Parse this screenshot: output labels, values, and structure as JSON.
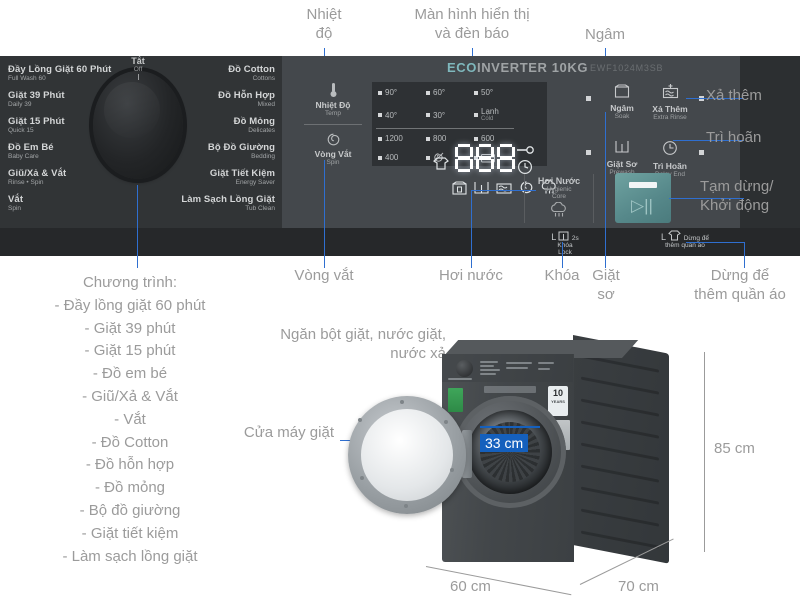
{
  "annotations": {
    "top": [
      {
        "text": "Nhiệt\nđộ",
        "name": "callout-temperature"
      },
      {
        "text": "Màn hình hiển thị\nvà đèn báo",
        "name": "callout-display"
      },
      {
        "text": "Ngâm",
        "name": "callout-soak"
      }
    ],
    "right": [
      {
        "text": "Xả thêm",
        "name": "callout-extra-rinse"
      },
      {
        "text": "Trì hoãn",
        "name": "callout-delay"
      },
      {
        "text": "Tạm dừng/\nKhởi động",
        "name": "callout-start-pause"
      }
    ],
    "bottom": [
      {
        "text": "Vòng vắt",
        "name": "callout-spin"
      },
      {
        "text": "Hơi nước",
        "name": "callout-steam"
      },
      {
        "text": "Khóa",
        "name": "callout-lock"
      },
      {
        "text": "Giặt\nsơ",
        "name": "callout-prewash"
      },
      {
        "text": "Dừng để\nthêm quần áo",
        "name": "callout-add-clothes"
      }
    ],
    "programs_block": "Chương trình:\n- Đầy lồng giặt 60 phút\n- Giặt 39 phút\n- Giặt 15 phút\n- Đồ em bé\n- Giũ/Xả & Vắt\n- Vắt\n- Đồ Cotton\n- Đồ hỗn hợp\n- Đồ mỏng\n- Bộ đồ giường\n- Giặt tiết kiệm\n- Làm sạch lồng giặt",
    "detergent_drawer": "Ngăn bột giặt, nước giặt,\nnước xả",
    "door": "Cửa máy giặt"
  },
  "panel": {
    "brand_eco": "ECO",
    "brand_rest": "INVERTER 10KG",
    "model": "EWF1024M3SB",
    "knob_off_vn": "Tắt",
    "knob_off_en": "Off",
    "programs_left": [
      {
        "vn": "Đầy Lồng Giặt 60 Phút",
        "en": "Full Wash 60"
      },
      {
        "vn": "Giặt 39 Phút",
        "en": "Daily 39"
      },
      {
        "vn": "Giặt 15 Phút",
        "en": "Quick 15"
      },
      {
        "vn": "Đồ Em Bé",
        "en": "Baby Care"
      },
      {
        "vn": "Giũ/Xả & Vắt",
        "en": "Rinse • Spin"
      },
      {
        "vn": "Vắt",
        "en": "Spin"
      }
    ],
    "programs_right": [
      {
        "vn": "Đồ Cotton",
        "en": "Cottons"
      },
      {
        "vn": "Đồ Hỗn Hợp",
        "en": "Mixed"
      },
      {
        "vn": "Đồ Mỏng",
        "en": "Delicates"
      },
      {
        "vn": "Bộ Đồ Giường",
        "en": "Bedding"
      },
      {
        "vn": "Giặt Tiết Kiệm",
        "en": "Energy Saver"
      },
      {
        "vn": "Làm Sạch Lồng Giặt",
        "en": "Tub Clean"
      }
    ],
    "temp_button": {
      "vn": "Nhiệt Độ",
      "en": "Temp",
      "icon": "thermometer-icon"
    },
    "spin_button": {
      "vn": "Vòng Vắt",
      "en": "Spin",
      "icon": "spiral-icon"
    },
    "temperatures": [
      {
        "label": "90°"
      },
      {
        "label": "60°"
      },
      {
        "label": "50°"
      },
      {
        "label": "40°"
      },
      {
        "label": "30°"
      },
      {
        "label": "Lạnh",
        "sub": "Cold"
      }
    ],
    "spin_speeds": [
      {
        "label": "1200"
      },
      {
        "label": "800"
      },
      {
        "label": "600"
      },
      {
        "label": "400"
      },
      {
        "label": "no-spin-icon"
      },
      {
        "label": "rinse-hold-icon"
      }
    ],
    "led_value": "888",
    "display_icons_top": [
      "shirt-icon",
      "key-icon",
      "clock-icon"
    ],
    "display_icons_bottom": [
      "prewash-icon",
      "wash-icon",
      "rinse-icon",
      "spin-icon",
      "steam-icon"
    ],
    "option_buttons": [
      {
        "vn": "Ngâm",
        "en": "Soak",
        "icon": "soak-icon"
      },
      {
        "vn": "Xả Thêm",
        "en": "Extra Rinse",
        "icon": "extra-rinse-icon"
      },
      {
        "vn": "Giặt Sơ",
        "en": "Prewash",
        "icon": "prewash-icon"
      },
      {
        "vn": "Trì Hoãn",
        "en": "Delay End",
        "icon": "delay-clock-icon"
      }
    ],
    "steam": {
      "vn": "Hơi Nước",
      "en1": "Hygienic",
      "en2": "Core",
      "icon": "steam-icon"
    },
    "start_pause_icon": "play-pause-icon",
    "strip_lock": {
      "row1": "Khóa",
      "row2": "Lock",
      "prefix": "L",
      "suffix": "2s"
    },
    "strip_add": {
      "row1": "Dừng để",
      "row2": "thêm quần áo",
      "prefix": "L"
    }
  },
  "product": {
    "dim_width": "60 cm",
    "dim_depth": "70 cm",
    "dim_height": "85 cm",
    "dim_door": "33 cm",
    "badge_capacity": "10",
    "badge_sub": "YEARS"
  },
  "colors": {
    "accent_line": "#2f6fd0",
    "badge_blue": "#1560bd",
    "panel_dark": "#313436",
    "panel_mid": "#44484c",
    "teal_button": "#5a8f8f",
    "anno_text": "#9b9b9b"
  }
}
